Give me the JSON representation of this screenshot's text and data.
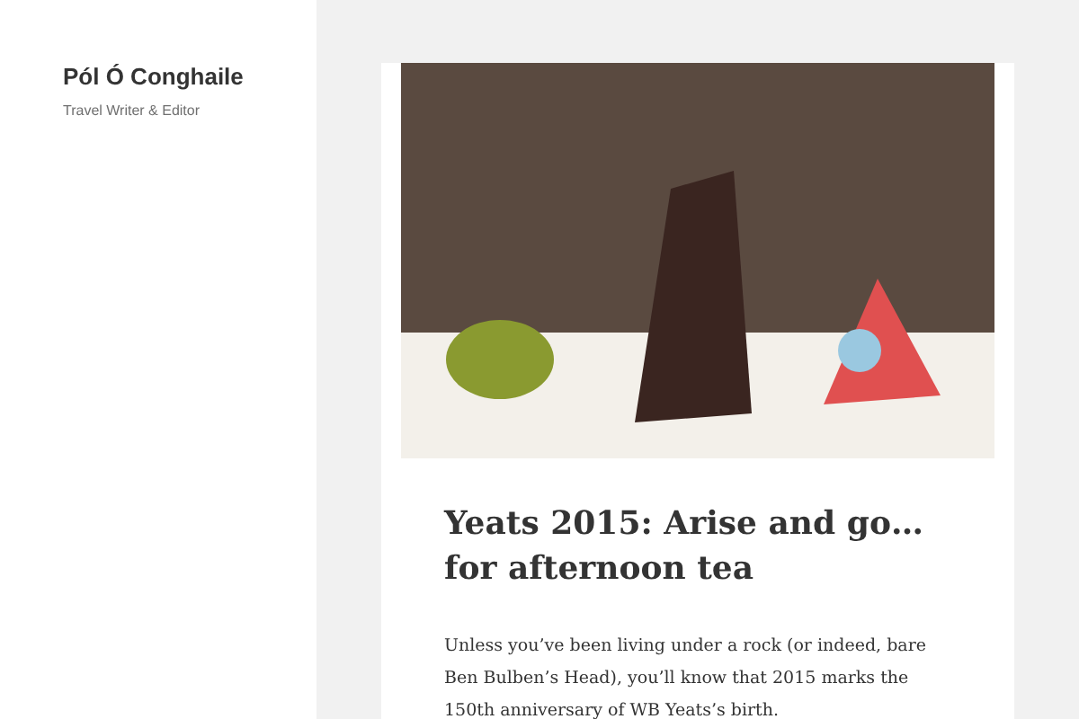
{
  "site": {
    "title": "Pól Ó Conghaile",
    "tagline": "Travel Writer & Editor"
  },
  "post": {
    "title": "Yeats 2015: Arise and go… for afternoon tea",
    "paragraphs": [
      "Unless you’ve been living under a rock (or indeed, bare Ben Bulben’s Head), you’ll know that 2015 marks the 150th anniversary of WB Yeats’s birth."
    ]
  }
}
